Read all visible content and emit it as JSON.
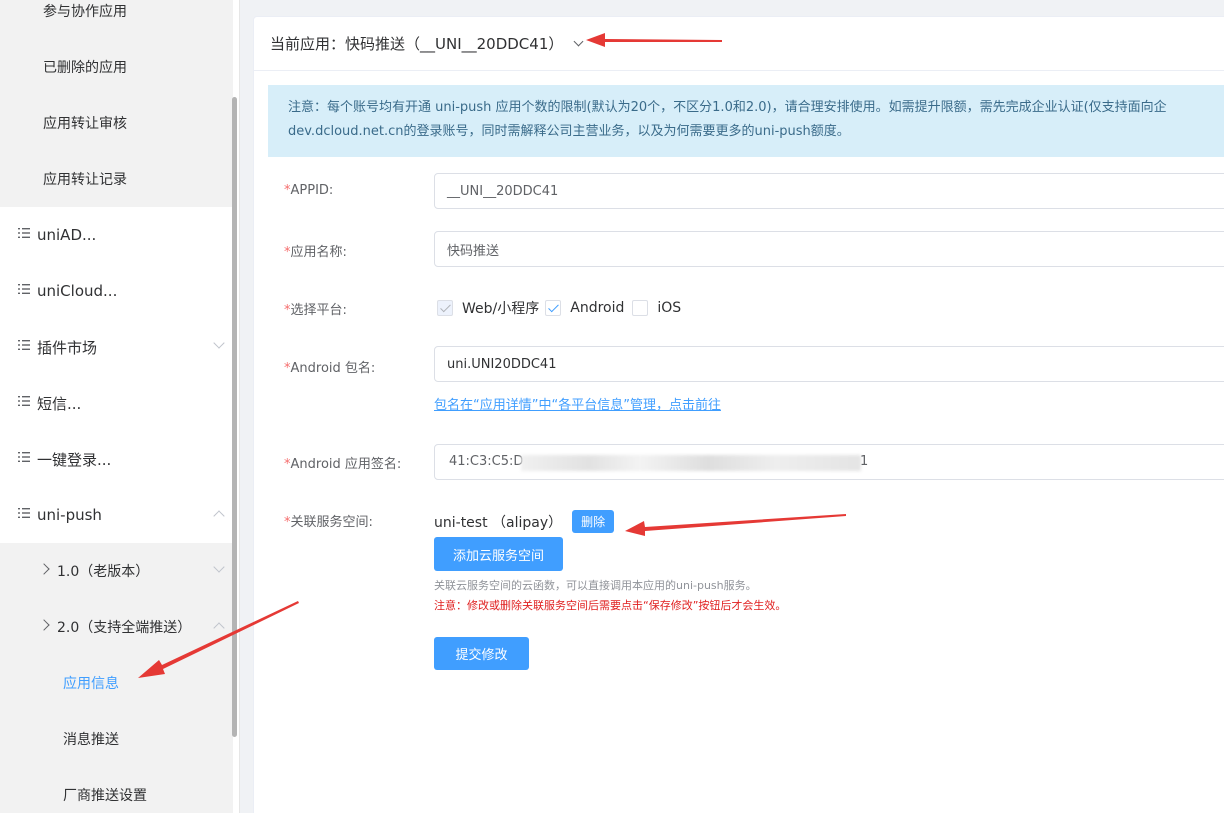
{
  "sidebar": {
    "items": [
      {
        "label": "参与协作应用"
      },
      {
        "label": "已删除的应用"
      },
      {
        "label": "应用转让审核"
      },
      {
        "label": "应用转让记录"
      },
      {
        "label": "uniAD..."
      },
      {
        "label": "uniCloud..."
      },
      {
        "label": "插件市场"
      },
      {
        "label": "短信..."
      },
      {
        "label": "一键登录..."
      },
      {
        "label": "uni-push"
      },
      {
        "label": "1.0（老版本）"
      },
      {
        "label": "2.0（支持全端推送）"
      },
      {
        "label": "应用信息"
      },
      {
        "label": "消息推送"
      },
      {
        "label": "厂商推送设置"
      }
    ]
  },
  "header": {
    "title": "当前应用：快码推送（__UNI__20DDC41）"
  },
  "notice": {
    "line1": "注意：每个账号均有开通 uni-push 应用个数的限制(默认为20个，不区分1.0和2.0)，请合理安排使用。如需提升限额，需先完成企业认证(仅支持面向企",
    "line2": "dev.dcloud.net.cn的登录账号，同时需解释公司主营业务，以及为何需要更多的uni-push额度。"
  },
  "form": {
    "appid_label": "APPID:",
    "appid_value": "__UNI__20DDC41",
    "name_label": "应用名称:",
    "name_value": "快码推送",
    "platform_label": "选择平台:",
    "platforms": [
      {
        "label": "Web/小程序",
        "checked": true,
        "disabled": true
      },
      {
        "label": "Android",
        "checked": true,
        "disabled": false
      },
      {
        "label": "iOS",
        "checked": false,
        "disabled": false
      }
    ],
    "package_label": "Android 包名:",
    "package_value": "uni.UNI20DDC41",
    "package_link": "包名在“应用详情”中“各平台信息”管理，点击前往",
    "signature_label": "Android 应用签名:",
    "signature_prefix": "41:C3:C5:D",
    "signature_suffix": "1",
    "service_label": "关联服务空间:",
    "service_name": "uni-test （alipay）",
    "delete_label": "删除",
    "add_service_label": "添加云服务空间",
    "service_hint": "关联云服务空间的云函数，可以直接调用本应用的uni-push服务。",
    "service_warning": "注意：修改或删除关联服务空间后需要点击“保存修改”按钮后才会生效。",
    "submit_label": "提交修改",
    "required_mark": "*"
  },
  "colors": {
    "accent": "#409eff",
    "annotation": "#e53935",
    "warning": "#e02020"
  }
}
